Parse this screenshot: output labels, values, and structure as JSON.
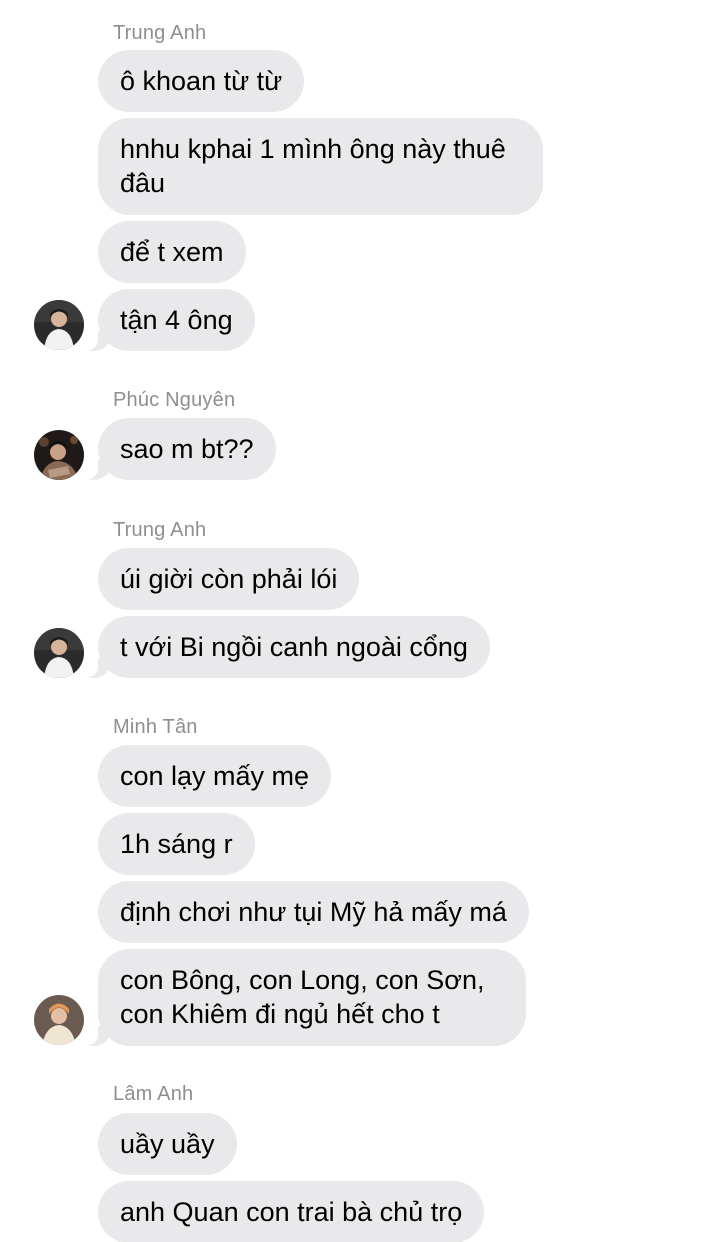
{
  "groups": [
    {
      "sender": "Trung Anh",
      "messages": [
        "ô khoan từ từ",
        "hnhu kphai 1 mình ông này thuê\nđâu",
        "để t xem",
        "tận 4 ông"
      ]
    },
    {
      "sender": "Phúc Nguyên",
      "messages": [
        "sao m bt??"
      ]
    },
    {
      "sender": "Trung Anh",
      "messages": [
        "úi giời còn phải lói",
        "t với Bi ngồi canh ngoài cổng"
      ]
    },
    {
      "sender": "Minh Tân",
      "messages": [
        "con lạy mấy mẹ",
        "1h sáng r",
        "định chơi như tụi Mỹ hả mấy má",
        "con Bông, con Long, con Sơn,\ncon Khiêm đi ngủ hết cho t"
      ]
    },
    {
      "sender": "Lâm Anh",
      "messages": [
        "uầy uầy",
        "anh Quan con trai bà chủ trọ"
      ]
    }
  ],
  "colors": {
    "bubble": "#e9e9eb",
    "sender_name": "#8e8e93",
    "background": "#ffffff"
  },
  "icons": [
    "avatar-trung-anh",
    "avatar-phuc-nguyen",
    "avatar-minh-tan"
  ]
}
